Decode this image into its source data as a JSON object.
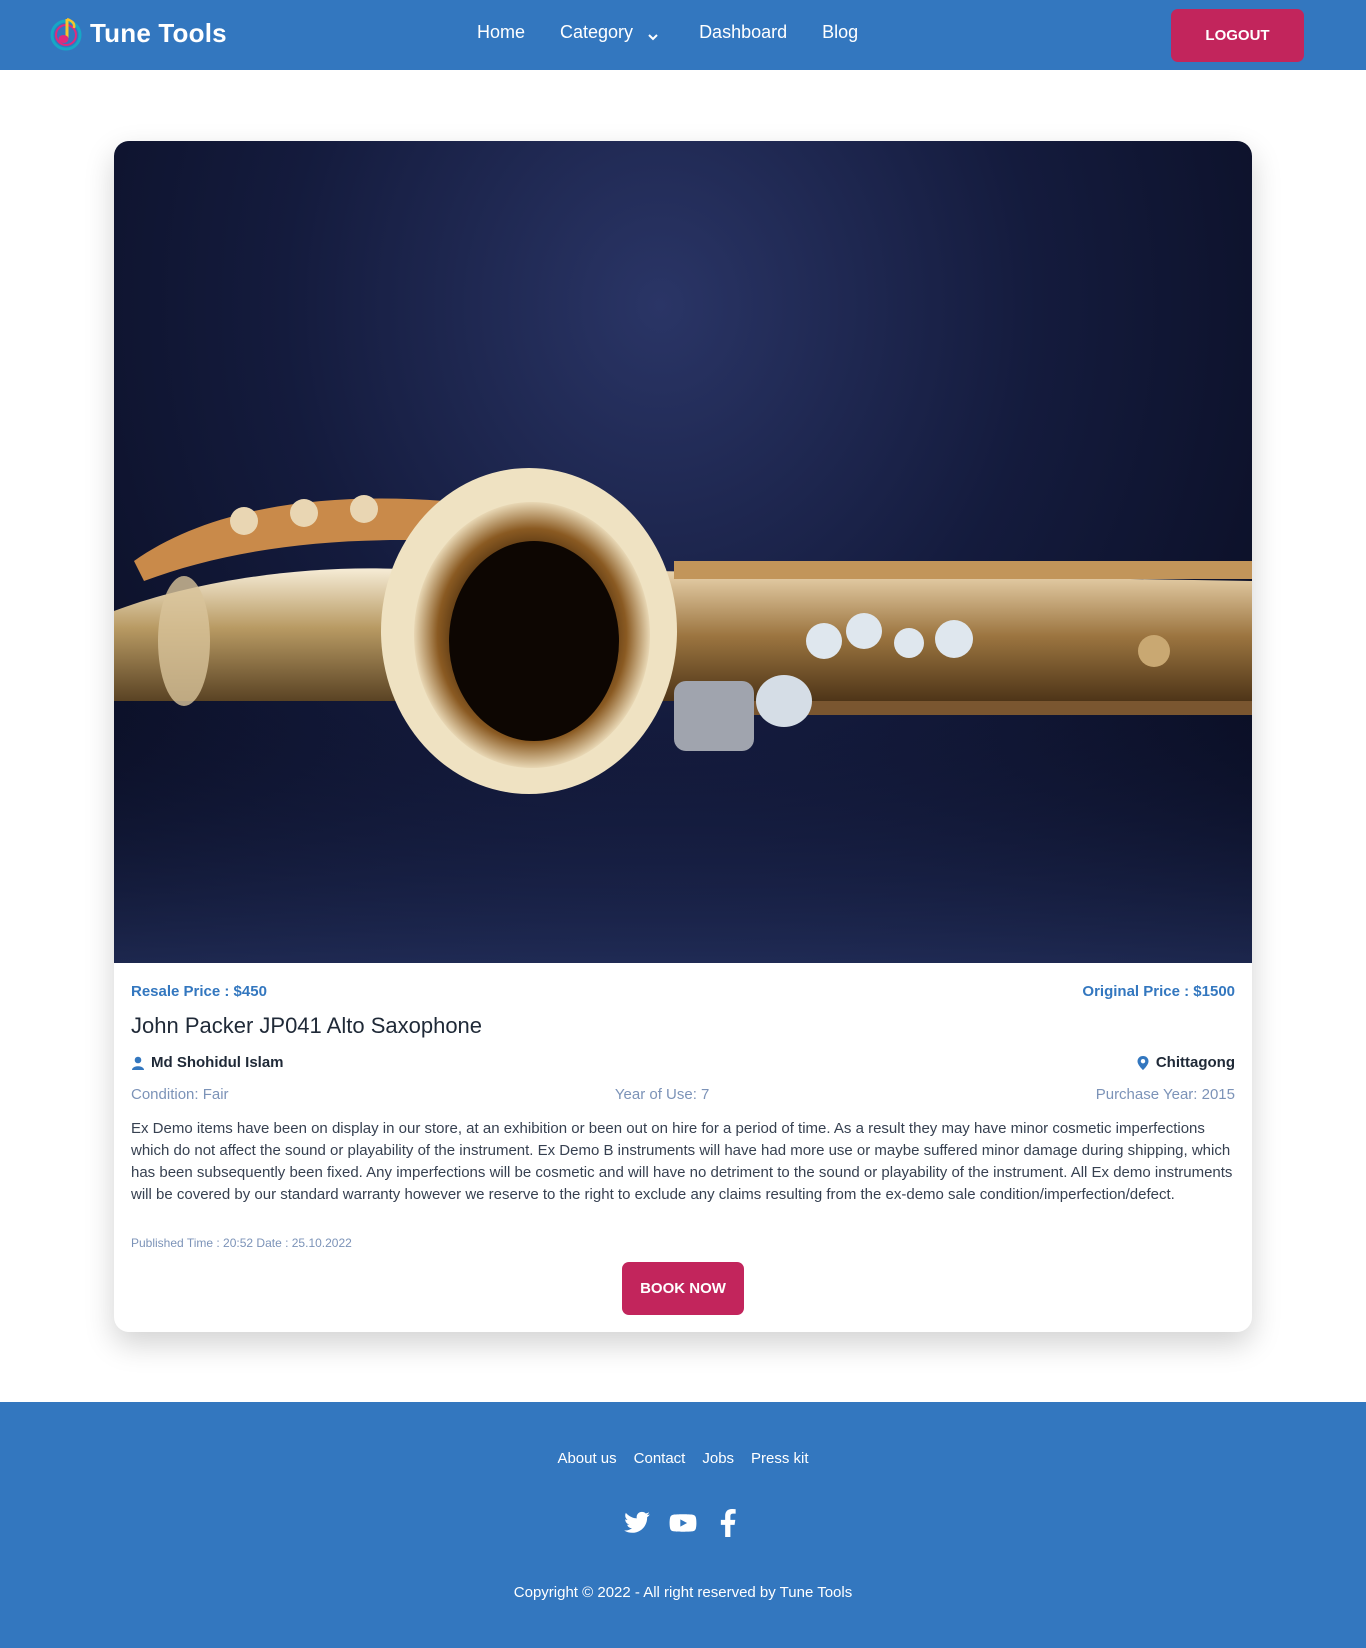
{
  "navbar": {
    "brand": "Tune Tools",
    "links": {
      "home": "Home",
      "category": "Category",
      "dashboard": "Dashboard",
      "blog": "Blog"
    },
    "logout_label": "LOGOUT",
    "colors": {
      "bar": "#3377bf",
      "button": "#c2255c"
    }
  },
  "product": {
    "resale_price": "Resale Price : $450",
    "original_price": "Original Price : $1500",
    "title": "John Packer JP041 Alto Saxophone",
    "seller": "Md Shohidul Islam",
    "location": "Chittagong",
    "condition": "Condition: Fair",
    "year_of_use": "Year of Use: 7",
    "purchase_year": "Purchase Year: 2015",
    "description": "Ex Demo items have been on display in our store, at an exhibition or been out on hire for a period of time. As a result they may have minor cosmetic imperfections which do not affect the sound or playability of the instrument. Ex Demo B instruments will have had more use or maybe suffered minor damage during shipping, which has been subsequently been fixed. Any imperfections will be cosmetic and will have no detriment to the sound or playability of the instrument. All Ex demo instruments will be covered by our standard warranty however we reserve to the right to exclude any claims resulting from the ex-demo sale condition/imperfection/defect.",
    "published": "Published Time : 20:52 Date : 25.10.2022",
    "book_label": "BOOK NOW",
    "image_icon": "saxophone-photo"
  },
  "footer": {
    "links": {
      "about": "About us",
      "contact": "Contact",
      "jobs": "Jobs",
      "press": "Press kit"
    },
    "social_icons": [
      "twitter-icon",
      "youtube-icon",
      "facebook-icon"
    ],
    "copyright": "Copyright © 2022 - All right reserved by Tune Tools"
  }
}
